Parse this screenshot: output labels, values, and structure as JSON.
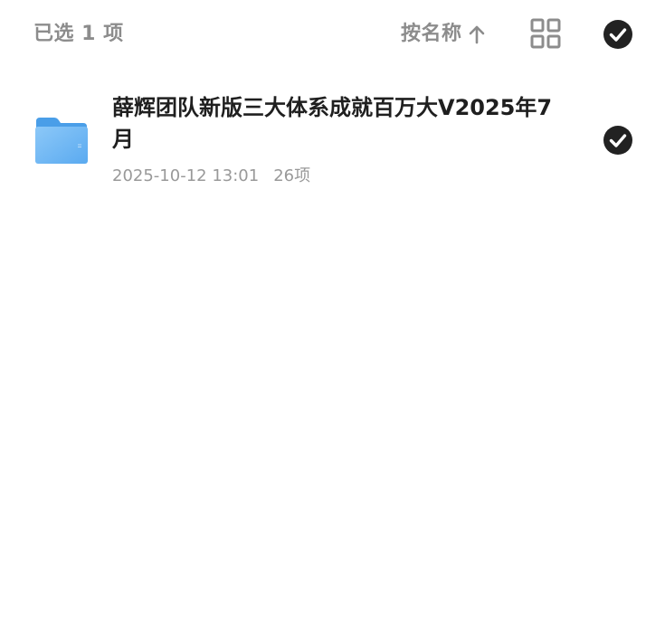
{
  "header": {
    "selected_label": "已选 1 项",
    "sort_label": "按名称",
    "sort_icon": "arrow-up-icon",
    "view_icon": "grid-view-icon",
    "select_all_icon": "check-circle-icon"
  },
  "items": [
    {
      "name": "薛辉团队新版三大体系成就百万大V2025年7月",
      "date": "2025-10-12 13:01",
      "count": "26项",
      "icon": "folder-icon",
      "selected": true
    }
  ],
  "colors": {
    "muted_text": "#8c8c8c",
    "meta_text": "#999999",
    "check_fill": "#222222",
    "folder_blue": "#5aaaf0"
  }
}
